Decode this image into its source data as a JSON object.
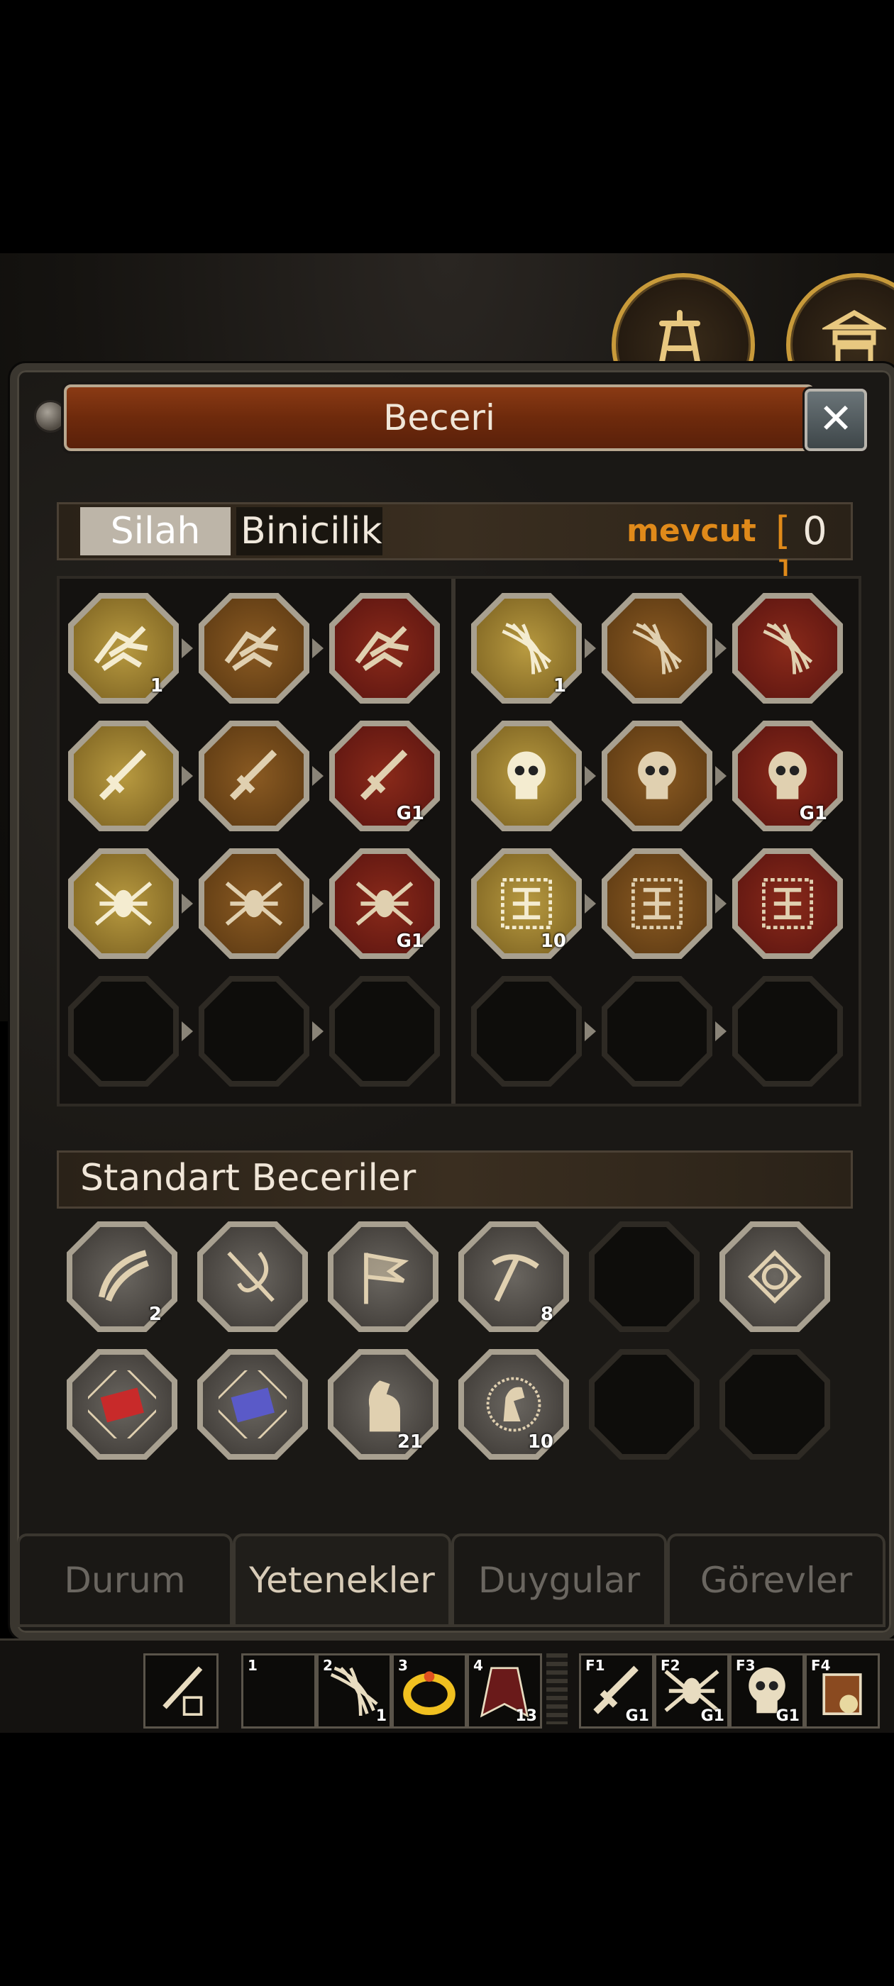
{
  "window": {
    "title": "Beceri",
    "close_label": "✕"
  },
  "skill_tabs": {
    "silah": "Silah",
    "binicilik": "Binicilik"
  },
  "points": {
    "label": "mevcut",
    "open": "[",
    "value": "0",
    "close": "]"
  },
  "skill_grid": [
    {
      "row": 1,
      "slots": [
        {
          "icon": "claw-icon",
          "tier": "gold",
          "level": "1"
        },
        {
          "icon": "claw-icon",
          "tier": "brown",
          "level": ""
        },
        {
          "icon": "claw-icon",
          "tier": "red",
          "level": ""
        },
        {
          "icon": "whirlwind-icon",
          "tier": "gold",
          "level": "1"
        },
        {
          "icon": "whirlwind-icon",
          "tier": "brown",
          "level": ""
        },
        {
          "icon": "whirlwind-icon",
          "tier": "red",
          "level": ""
        }
      ]
    },
    {
      "row": 2,
      "slots": [
        {
          "icon": "sword-icon",
          "tier": "gold",
          "level": ""
        },
        {
          "icon": "sword-icon",
          "tier": "brown",
          "level": ""
        },
        {
          "icon": "sword-icon",
          "tier": "red",
          "level": "G1"
        },
        {
          "icon": "skull-icon",
          "tier": "gold",
          "level": ""
        },
        {
          "icon": "skull-icon",
          "tier": "brown",
          "level": ""
        },
        {
          "icon": "skull-icon",
          "tier": "red",
          "level": "G1"
        }
      ]
    },
    {
      "row": 3,
      "slots": [
        {
          "icon": "spider-icon",
          "tier": "gold",
          "level": ""
        },
        {
          "icon": "spider-icon",
          "tier": "brown",
          "level": ""
        },
        {
          "icon": "spider-icon",
          "tier": "red",
          "level": "G1"
        },
        {
          "icon": "rune-icon",
          "tier": "gold",
          "level": "10"
        },
        {
          "icon": "rune-icon",
          "tier": "brown",
          "level": ""
        },
        {
          "icon": "rune-icon",
          "tier": "red",
          "level": ""
        }
      ]
    },
    {
      "row": 4,
      "slots": [
        {
          "icon": "empty-slot",
          "tier": "empty",
          "level": ""
        },
        {
          "icon": "empty-slot",
          "tier": "empty",
          "level": ""
        },
        {
          "icon": "empty-slot",
          "tier": "empty",
          "level": ""
        },
        {
          "icon": "empty-slot",
          "tier": "empty",
          "level": ""
        },
        {
          "icon": "empty-slot",
          "tier": "empty",
          "level": ""
        },
        {
          "icon": "empty-slot",
          "tier": "empty",
          "level": ""
        }
      ]
    }
  ],
  "standard_skills": {
    "header": "Standart Beceriler",
    "rows": [
      [
        {
          "icon": "slash-icon",
          "level": "2"
        },
        {
          "icon": "fishing-rod-icon",
          "level": ""
        },
        {
          "icon": "flag-icon",
          "level": ""
        },
        {
          "icon": "pickaxe-icon",
          "level": "8"
        },
        {
          "icon": "empty-slot",
          "level": ""
        },
        {
          "icon": "knot-icon",
          "level": ""
        }
      ],
      [
        {
          "icon": "red-book-icon",
          "level": ""
        },
        {
          "icon": "blue-book-icon",
          "level": ""
        },
        {
          "icon": "horse-icon",
          "level": "21"
        },
        {
          "icon": "horse-head-icon",
          "level": "10"
        },
        {
          "icon": "empty-slot",
          "level": ""
        },
        {
          "icon": "empty-slot",
          "level": ""
        }
      ]
    ]
  },
  "bottom_tabs": [
    "Durum",
    "Yetenekler",
    "Duygular",
    "Görevler"
  ],
  "active_bottom_tab": "Yetenekler",
  "hotbar": [
    {
      "key": "",
      "icon": "sword-lock-icon",
      "level": ""
    },
    {
      "key": "1",
      "icon": "empty-slot",
      "level": ""
    },
    {
      "key": "2",
      "icon": "whirlwind-icon",
      "level": "1"
    },
    {
      "key": "3",
      "icon": "ring-icon",
      "level": ""
    },
    {
      "key": "4",
      "icon": "cloak-icon",
      "level": "13"
    },
    {
      "key": "F1",
      "icon": "sword-icon",
      "level": "G1"
    },
    {
      "key": "F2",
      "icon": "spider-icon",
      "level": "G1"
    },
    {
      "key": "F3",
      "icon": "skull-icon",
      "level": "G1"
    },
    {
      "key": "F4",
      "icon": "bag-icon",
      "level": ""
    }
  ],
  "colors": {
    "accent": "#e08a1a",
    "title_bar": "#7a2e10",
    "frame": "#3a362f",
    "hud_ring": "#c89a3a"
  }
}
